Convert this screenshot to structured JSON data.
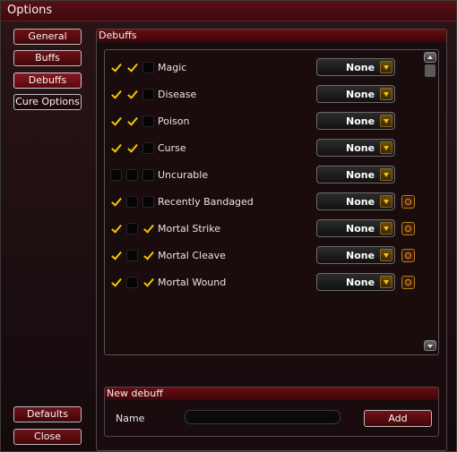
{
  "window": {
    "title": "Options"
  },
  "nav": {
    "general": "General",
    "buffs": "Buffs",
    "debuffs": "Debuffs",
    "cure_options": "Cure Options",
    "defaults": "Defaults",
    "close": "Close"
  },
  "debuffs_panel": {
    "header": "Debuffs",
    "rows": [
      {
        "label": "Magic",
        "checks": [
          true,
          true,
          false
        ],
        "dropdown": "None",
        "has_action": false
      },
      {
        "label": "Disease",
        "checks": [
          true,
          true,
          false
        ],
        "dropdown": "None",
        "has_action": false
      },
      {
        "label": "Poison",
        "checks": [
          true,
          true,
          false
        ],
        "dropdown": "None",
        "has_action": false
      },
      {
        "label": "Curse",
        "checks": [
          true,
          true,
          false
        ],
        "dropdown": "None",
        "has_action": false
      },
      {
        "label": "Uncurable",
        "checks": [
          false,
          false,
          false
        ],
        "dropdown": "None",
        "has_action": false
      },
      {
        "label": "Recently Bandaged",
        "checks": [
          true,
          false,
          false
        ],
        "dropdown": "None",
        "has_action": true
      },
      {
        "label": "Mortal Strike",
        "checks": [
          true,
          false,
          true
        ],
        "dropdown": "None",
        "has_action": true
      },
      {
        "label": "Mortal Cleave",
        "checks": [
          true,
          false,
          true
        ],
        "dropdown": "None",
        "has_action": true
      },
      {
        "label": "Mortal Wound",
        "checks": [
          true,
          false,
          true
        ],
        "dropdown": "None",
        "has_action": true
      }
    ]
  },
  "new_debuff": {
    "header": "New debuff",
    "name_label": "Name",
    "name_value": "",
    "add_label": "Add"
  },
  "icons": {
    "checkbox": "checkmark-icon",
    "dropdown_arrow": "chevron-down-icon",
    "row_action": "gear-icon",
    "scroll_up": "chevron-up-icon",
    "scroll_down": "chevron-down-icon"
  },
  "colors": {
    "accent": "#f0c800",
    "header": "#5a0f14",
    "button": "#6e1218"
  }
}
